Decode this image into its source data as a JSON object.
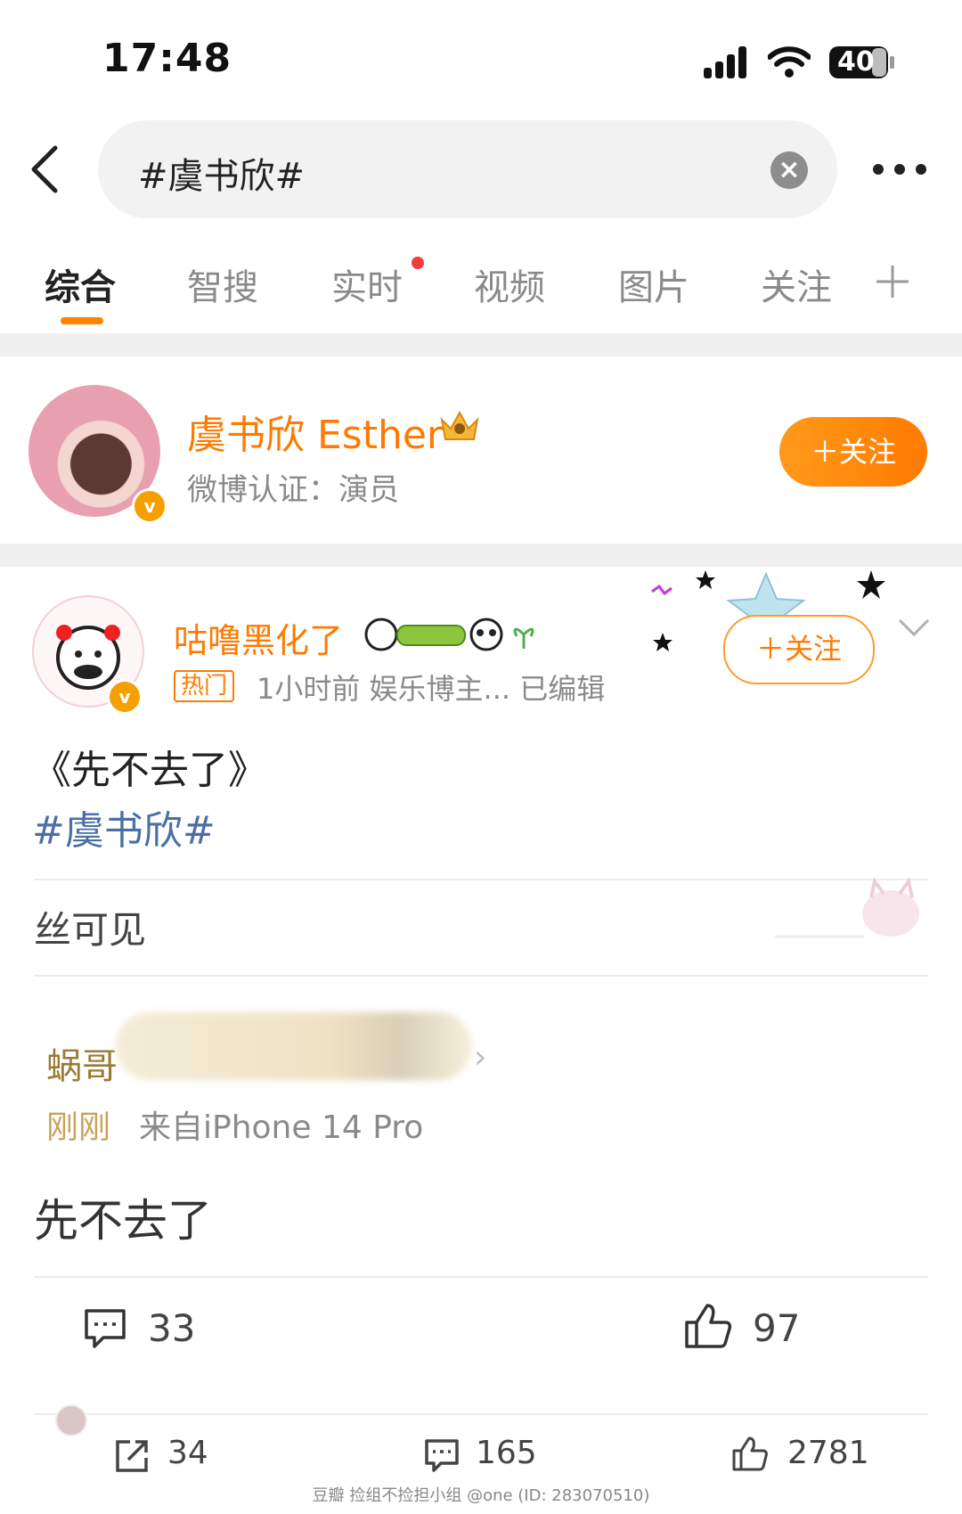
{
  "status": {
    "time": "17:48",
    "battery": "40"
  },
  "search": {
    "query": "#虞书欣#"
  },
  "tabs": [
    "综合",
    "智搜",
    "实时",
    "视频",
    "图片",
    "关注"
  ],
  "user_card": {
    "name": "虞书欣 Esther",
    "verify": "微博认证：演员",
    "follow_label": "＋关注"
  },
  "post": {
    "author": "咕噜黑化了",
    "hot_tag": "热门",
    "meta": "1小时前  娱乐博主...  已编辑",
    "follow_label": "＋关注",
    "text": "《先不去了》",
    "topic": "#虞书欣#",
    "embedded": {
      "visibility": "丝可见",
      "name": "蜗哥",
      "time": "刚刚",
      "source": "来自iPhone 14 Pro",
      "text": "先不去了",
      "comments": "33",
      "likes": "97"
    },
    "actions": {
      "reposts": "34",
      "comments": "165",
      "likes": "2781"
    }
  },
  "watermark": "豆瓣  捡组不捡担小组 @one (ID: 283070510)",
  "colors": {
    "accent": "#ff7a00",
    "topic": "#4a6fa5",
    "dot": "#f03c3c"
  }
}
